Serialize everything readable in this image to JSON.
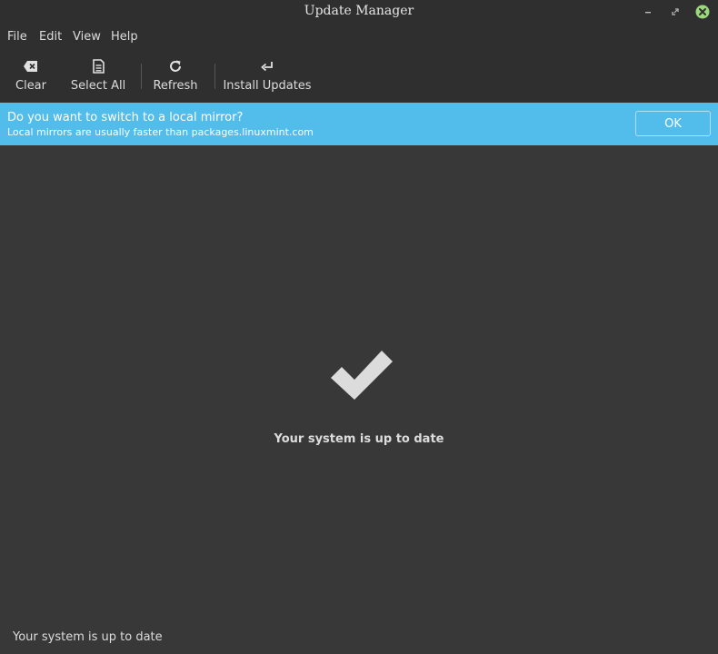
{
  "window": {
    "title": "Update Manager"
  },
  "menubar": {
    "items": [
      {
        "label": "File"
      },
      {
        "label": "Edit"
      },
      {
        "label": "View"
      },
      {
        "label": "Help"
      }
    ]
  },
  "toolbar": {
    "clear": {
      "label": "Clear",
      "icon": "backspace-icon"
    },
    "select_all": {
      "label": "Select All",
      "icon": "document-icon"
    },
    "refresh": {
      "label": "Refresh",
      "icon": "refresh-icon"
    },
    "install_updates": {
      "label": "Install Updates",
      "icon": "enter-arrow-icon"
    }
  },
  "infobar": {
    "title": "Do you want to switch to a local mirror?",
    "subtitle": "Local mirrors are usually faster than packages.linuxmint.com",
    "ok_label": "OK",
    "color": "#52bceb"
  },
  "main": {
    "status_icon": "checkmark-icon",
    "status_message": "Your system is up to date"
  },
  "statusbar": {
    "text": "Your system is up to date"
  },
  "colors": {
    "background": "#383838",
    "chrome": "#2f2f2f",
    "close_button": "#9bd87c"
  }
}
